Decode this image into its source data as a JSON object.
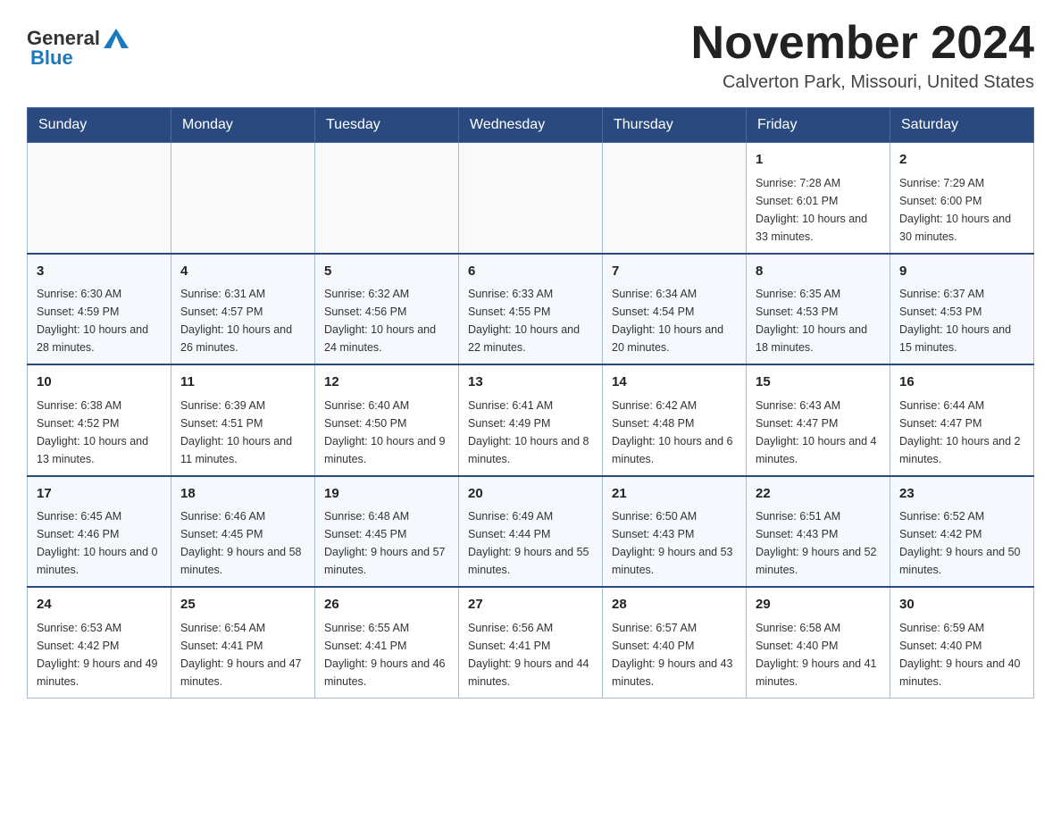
{
  "logo": {
    "general": "General",
    "blue": "Blue"
  },
  "title": "November 2024",
  "subtitle": "Calverton Park, Missouri, United States",
  "headers": [
    "Sunday",
    "Monday",
    "Tuesday",
    "Wednesday",
    "Thursday",
    "Friday",
    "Saturday"
  ],
  "weeks": [
    [
      {
        "day": "",
        "info": ""
      },
      {
        "day": "",
        "info": ""
      },
      {
        "day": "",
        "info": ""
      },
      {
        "day": "",
        "info": ""
      },
      {
        "day": "",
        "info": ""
      },
      {
        "day": "1",
        "info": "Sunrise: 7:28 AM\nSunset: 6:01 PM\nDaylight: 10 hours\nand 33 minutes."
      },
      {
        "day": "2",
        "info": "Sunrise: 7:29 AM\nSunset: 6:00 PM\nDaylight: 10 hours\nand 30 minutes."
      }
    ],
    [
      {
        "day": "3",
        "info": "Sunrise: 6:30 AM\nSunset: 4:59 PM\nDaylight: 10 hours\nand 28 minutes."
      },
      {
        "day": "4",
        "info": "Sunrise: 6:31 AM\nSunset: 4:57 PM\nDaylight: 10 hours\nand 26 minutes."
      },
      {
        "day": "5",
        "info": "Sunrise: 6:32 AM\nSunset: 4:56 PM\nDaylight: 10 hours\nand 24 minutes."
      },
      {
        "day": "6",
        "info": "Sunrise: 6:33 AM\nSunset: 4:55 PM\nDaylight: 10 hours\nand 22 minutes."
      },
      {
        "day": "7",
        "info": "Sunrise: 6:34 AM\nSunset: 4:54 PM\nDaylight: 10 hours\nand 20 minutes."
      },
      {
        "day": "8",
        "info": "Sunrise: 6:35 AM\nSunset: 4:53 PM\nDaylight: 10 hours\nand 18 minutes."
      },
      {
        "day": "9",
        "info": "Sunrise: 6:37 AM\nSunset: 4:53 PM\nDaylight: 10 hours\nand 15 minutes."
      }
    ],
    [
      {
        "day": "10",
        "info": "Sunrise: 6:38 AM\nSunset: 4:52 PM\nDaylight: 10 hours\nand 13 minutes."
      },
      {
        "day": "11",
        "info": "Sunrise: 6:39 AM\nSunset: 4:51 PM\nDaylight: 10 hours\nand 11 minutes."
      },
      {
        "day": "12",
        "info": "Sunrise: 6:40 AM\nSunset: 4:50 PM\nDaylight: 10 hours\nand 9 minutes."
      },
      {
        "day": "13",
        "info": "Sunrise: 6:41 AM\nSunset: 4:49 PM\nDaylight: 10 hours\nand 8 minutes."
      },
      {
        "day": "14",
        "info": "Sunrise: 6:42 AM\nSunset: 4:48 PM\nDaylight: 10 hours\nand 6 minutes."
      },
      {
        "day": "15",
        "info": "Sunrise: 6:43 AM\nSunset: 4:47 PM\nDaylight: 10 hours\nand 4 minutes."
      },
      {
        "day": "16",
        "info": "Sunrise: 6:44 AM\nSunset: 4:47 PM\nDaylight: 10 hours\nand 2 minutes."
      }
    ],
    [
      {
        "day": "17",
        "info": "Sunrise: 6:45 AM\nSunset: 4:46 PM\nDaylight: 10 hours\nand 0 minutes."
      },
      {
        "day": "18",
        "info": "Sunrise: 6:46 AM\nSunset: 4:45 PM\nDaylight: 9 hours\nand 58 minutes."
      },
      {
        "day": "19",
        "info": "Sunrise: 6:48 AM\nSunset: 4:45 PM\nDaylight: 9 hours\nand 57 minutes."
      },
      {
        "day": "20",
        "info": "Sunrise: 6:49 AM\nSunset: 4:44 PM\nDaylight: 9 hours\nand 55 minutes."
      },
      {
        "day": "21",
        "info": "Sunrise: 6:50 AM\nSunset: 4:43 PM\nDaylight: 9 hours\nand 53 minutes."
      },
      {
        "day": "22",
        "info": "Sunrise: 6:51 AM\nSunset: 4:43 PM\nDaylight: 9 hours\nand 52 minutes."
      },
      {
        "day": "23",
        "info": "Sunrise: 6:52 AM\nSunset: 4:42 PM\nDaylight: 9 hours\nand 50 minutes."
      }
    ],
    [
      {
        "day": "24",
        "info": "Sunrise: 6:53 AM\nSunset: 4:42 PM\nDaylight: 9 hours\nand 49 minutes."
      },
      {
        "day": "25",
        "info": "Sunrise: 6:54 AM\nSunset: 4:41 PM\nDaylight: 9 hours\nand 47 minutes."
      },
      {
        "day": "26",
        "info": "Sunrise: 6:55 AM\nSunset: 4:41 PM\nDaylight: 9 hours\nand 46 minutes."
      },
      {
        "day": "27",
        "info": "Sunrise: 6:56 AM\nSunset: 4:41 PM\nDaylight: 9 hours\nand 44 minutes."
      },
      {
        "day": "28",
        "info": "Sunrise: 6:57 AM\nSunset: 4:40 PM\nDaylight: 9 hours\nand 43 minutes."
      },
      {
        "day": "29",
        "info": "Sunrise: 6:58 AM\nSunset: 4:40 PM\nDaylight: 9 hours\nand 41 minutes."
      },
      {
        "day": "30",
        "info": "Sunrise: 6:59 AM\nSunset: 4:40 PM\nDaylight: 9 hours\nand 40 minutes."
      }
    ]
  ]
}
